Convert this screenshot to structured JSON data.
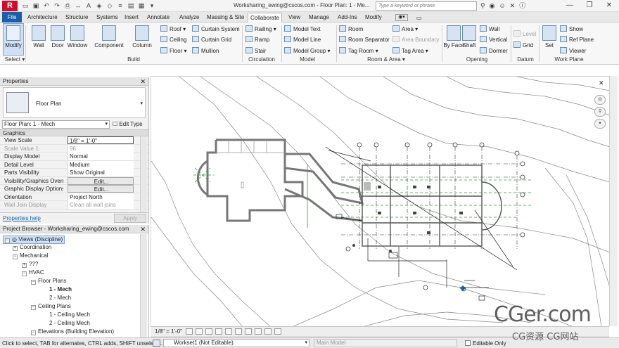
{
  "title_bar": {
    "logo": "R",
    "title": "Worksharing_ewing@cscos.com - Floor Plan: 1 - Me...",
    "search_placeholder": "Type a keyword or phrase",
    "help_label": "?"
  },
  "tabs": [
    {
      "label": "File"
    },
    {
      "label": "Architecture"
    },
    {
      "label": "Structure"
    },
    {
      "label": "Systems"
    },
    {
      "label": "Insert"
    },
    {
      "label": "Annotate"
    },
    {
      "label": "Analyze"
    },
    {
      "label": "Massing & Site"
    },
    {
      "label": "Collaborate"
    },
    {
      "label": "View"
    },
    {
      "label": "Manage"
    },
    {
      "label": "Add-Ins"
    },
    {
      "label": "Modify"
    }
  ],
  "ribbon": {
    "select_panel": {
      "label": "Select",
      "modify": "Modify"
    },
    "build_panel": {
      "label": "Build",
      "big": [
        "Wall",
        "Door",
        "Window",
        "Component",
        "Column"
      ],
      "col1": [
        "Roof",
        "Ceiling",
        "Floor"
      ],
      "col2": [
        "Curtain  System",
        "Curtain  Grid",
        "Mullion"
      ]
    },
    "circulation_panel": {
      "label": "Circulation",
      "items": [
        "Railing",
        "Ramp",
        "Stair"
      ]
    },
    "model_panel": {
      "label": "Model",
      "items": [
        "Model  Text",
        "Model  Line",
        "Model  Group"
      ]
    },
    "room_panel": {
      "label": "Room & Area",
      "items": [
        "Room",
        "Room  Separator",
        "Tag  Room",
        "Area",
        "Area  Boundary",
        "Tag  Area"
      ]
    },
    "opening_panel": {
      "label": "Opening",
      "big": [
        "By Face",
        "Shaft"
      ],
      "items": [
        "Wall",
        "Vertical",
        "Dormer"
      ]
    },
    "datum_panel": {
      "label": "Datum",
      "items": [
        "Level",
        "Grid"
      ]
    },
    "workplane_panel": {
      "label": "Work Plane",
      "big": "Set",
      "items": [
        "Show",
        "Ref  Plane",
        "Viewer"
      ]
    }
  },
  "properties": {
    "header": "Properties",
    "type_name": "Floor Plan",
    "instance_selector": "Floor Plan: 1 - Mech",
    "edit_type": "Edit Type",
    "group": "Graphics",
    "rows": [
      {
        "key": "View Scale",
        "value": "1/8\" = 1'-0\""
      },
      {
        "key": "Scale Value    1:",
        "value": "96"
      },
      {
        "key": "Display Model",
        "value": "Normal"
      },
      {
        "key": "Detail Level",
        "value": "Medium"
      },
      {
        "key": "Parts Visibility",
        "value": "Show Original"
      },
      {
        "key": "Visibility/Graphics Overr...",
        "value": "Edit..."
      },
      {
        "key": "Graphic Display Options",
        "value": "Edit..."
      },
      {
        "key": "Orientation",
        "value": "Project North"
      },
      {
        "key": "Wall Join Display",
        "value": "Clean all wall joins"
      }
    ],
    "help_link": "Properties help",
    "apply": "Apply"
  },
  "project_browser": {
    "header": "Project Browser - Worksharing_ewing@cscos.com",
    "nodes": [
      {
        "label": "Views (Discipline)",
        "toggle": "−"
      },
      {
        "label": "Coordination",
        "toggle": "+"
      },
      {
        "label": "Mechanical",
        "toggle": "−"
      },
      {
        "label": "???",
        "toggle": "+"
      },
      {
        "label": "HVAC",
        "toggle": "−"
      },
      {
        "label": "Floor Plans",
        "toggle": "−"
      },
      {
        "label": "1 - Mech",
        "toggle": ""
      },
      {
        "label": "2 - Mech",
        "toggle": ""
      },
      {
        "label": "Ceiling Plans",
        "toggle": "−"
      },
      {
        "label": "1 - Ceiling Mech",
        "toggle": ""
      },
      {
        "label": "2 - Ceiling Mech",
        "toggle": ""
      },
      {
        "label": "Elevations (Building Elevation)",
        "toggle": "−"
      }
    ]
  },
  "view_control": {
    "scale": "1/8\" = 1'-0\""
  },
  "status_bar": {
    "message": "Click to select, TAB for alternates, CTRL adds, SHIFT unselects.",
    "workset": "Workset1 (Not Editable)",
    "model": "Main Model",
    "editable_only": "Editable Only"
  },
  "watermark": {
    "main": "CGer.com",
    "sub": "CG资源 CG网站"
  }
}
